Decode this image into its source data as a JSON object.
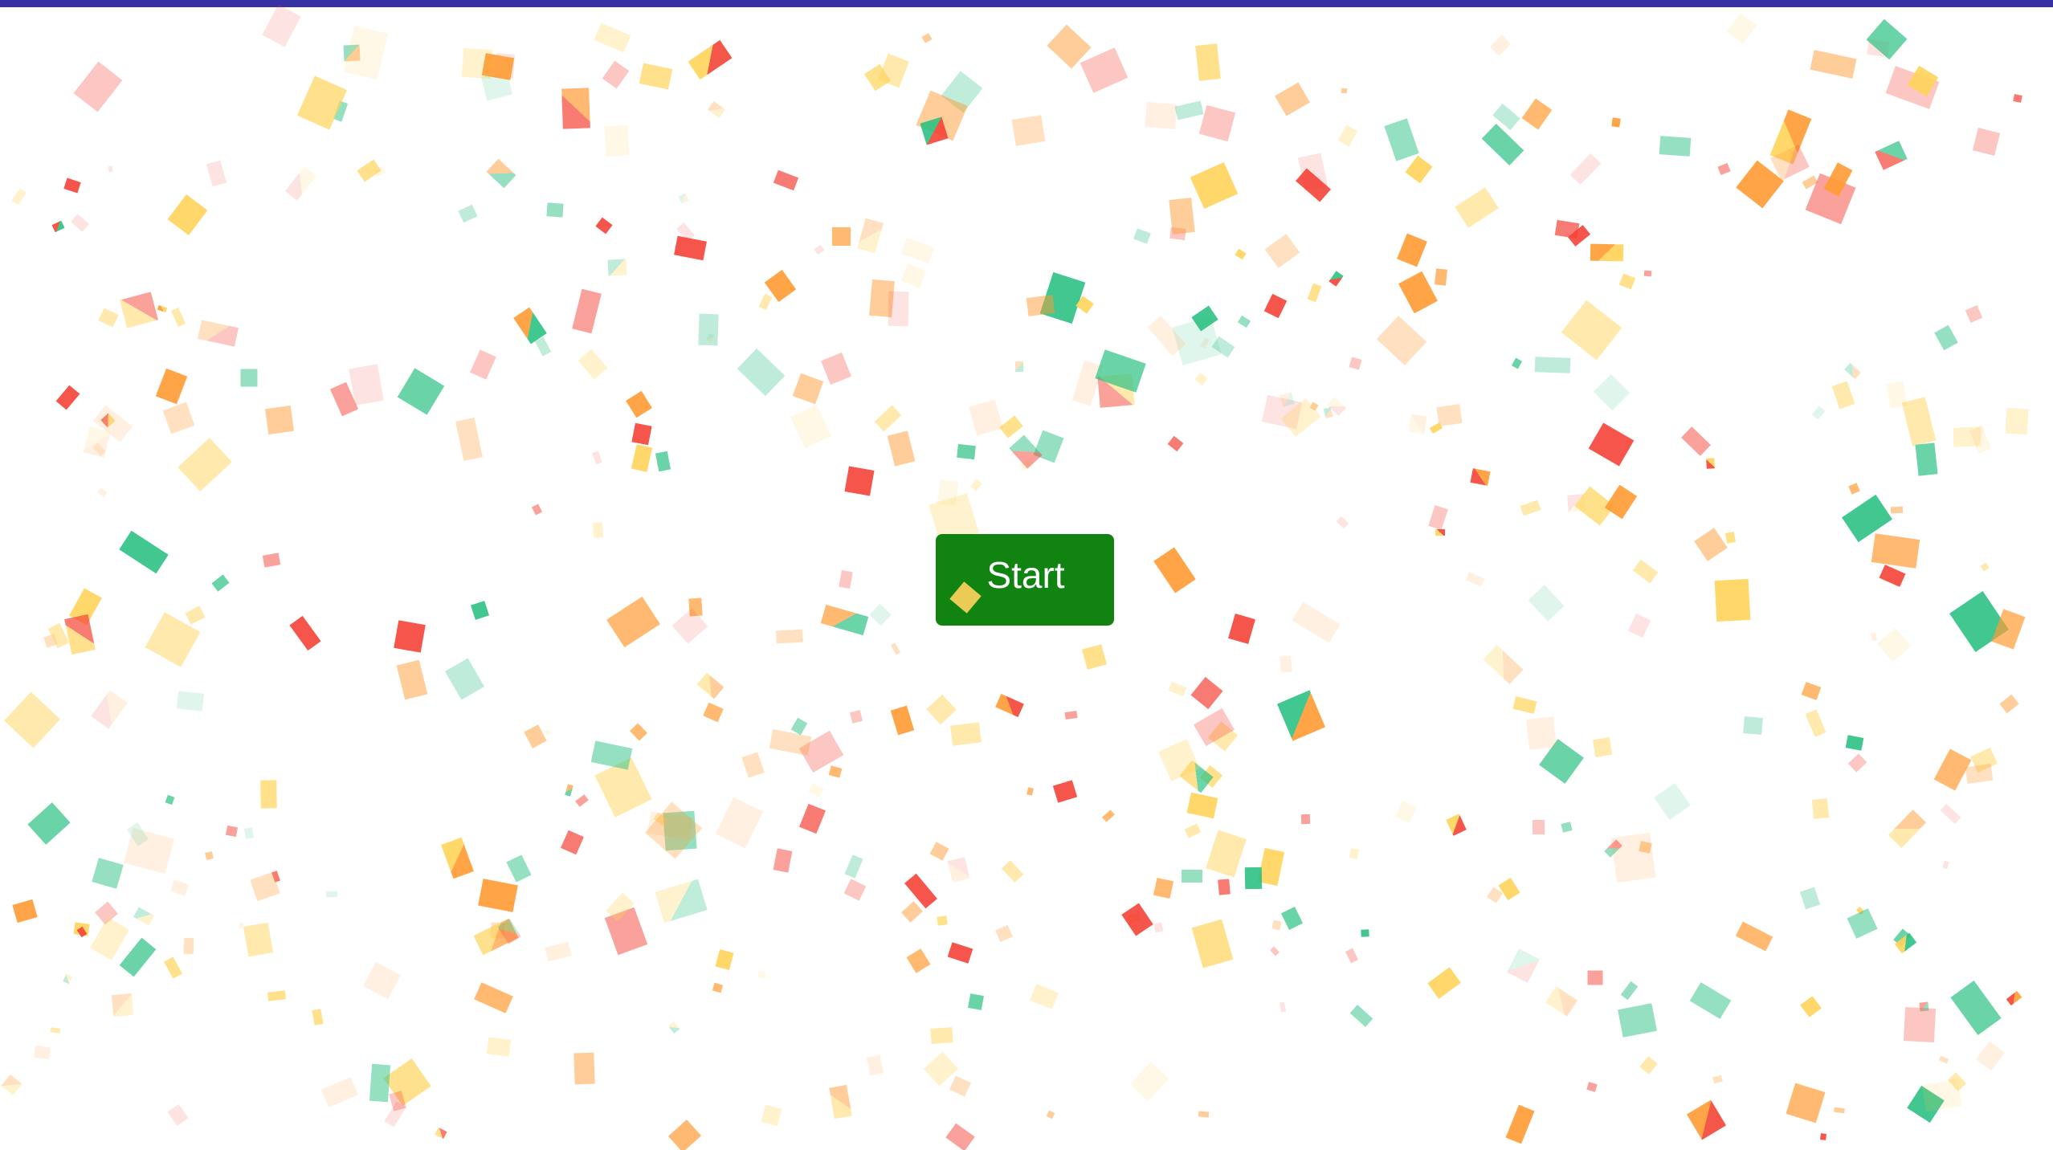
{
  "start_button": {
    "label": "Start"
  },
  "colors": {
    "top_bar": "#3731a3",
    "button_bg": "#118311",
    "button_text": "#ffffff",
    "confetti": [
      "#f44336",
      "#ff9b33",
      "#ffd35a",
      "#2cc183"
    ]
  },
  "confetti_piece_shape": "square"
}
